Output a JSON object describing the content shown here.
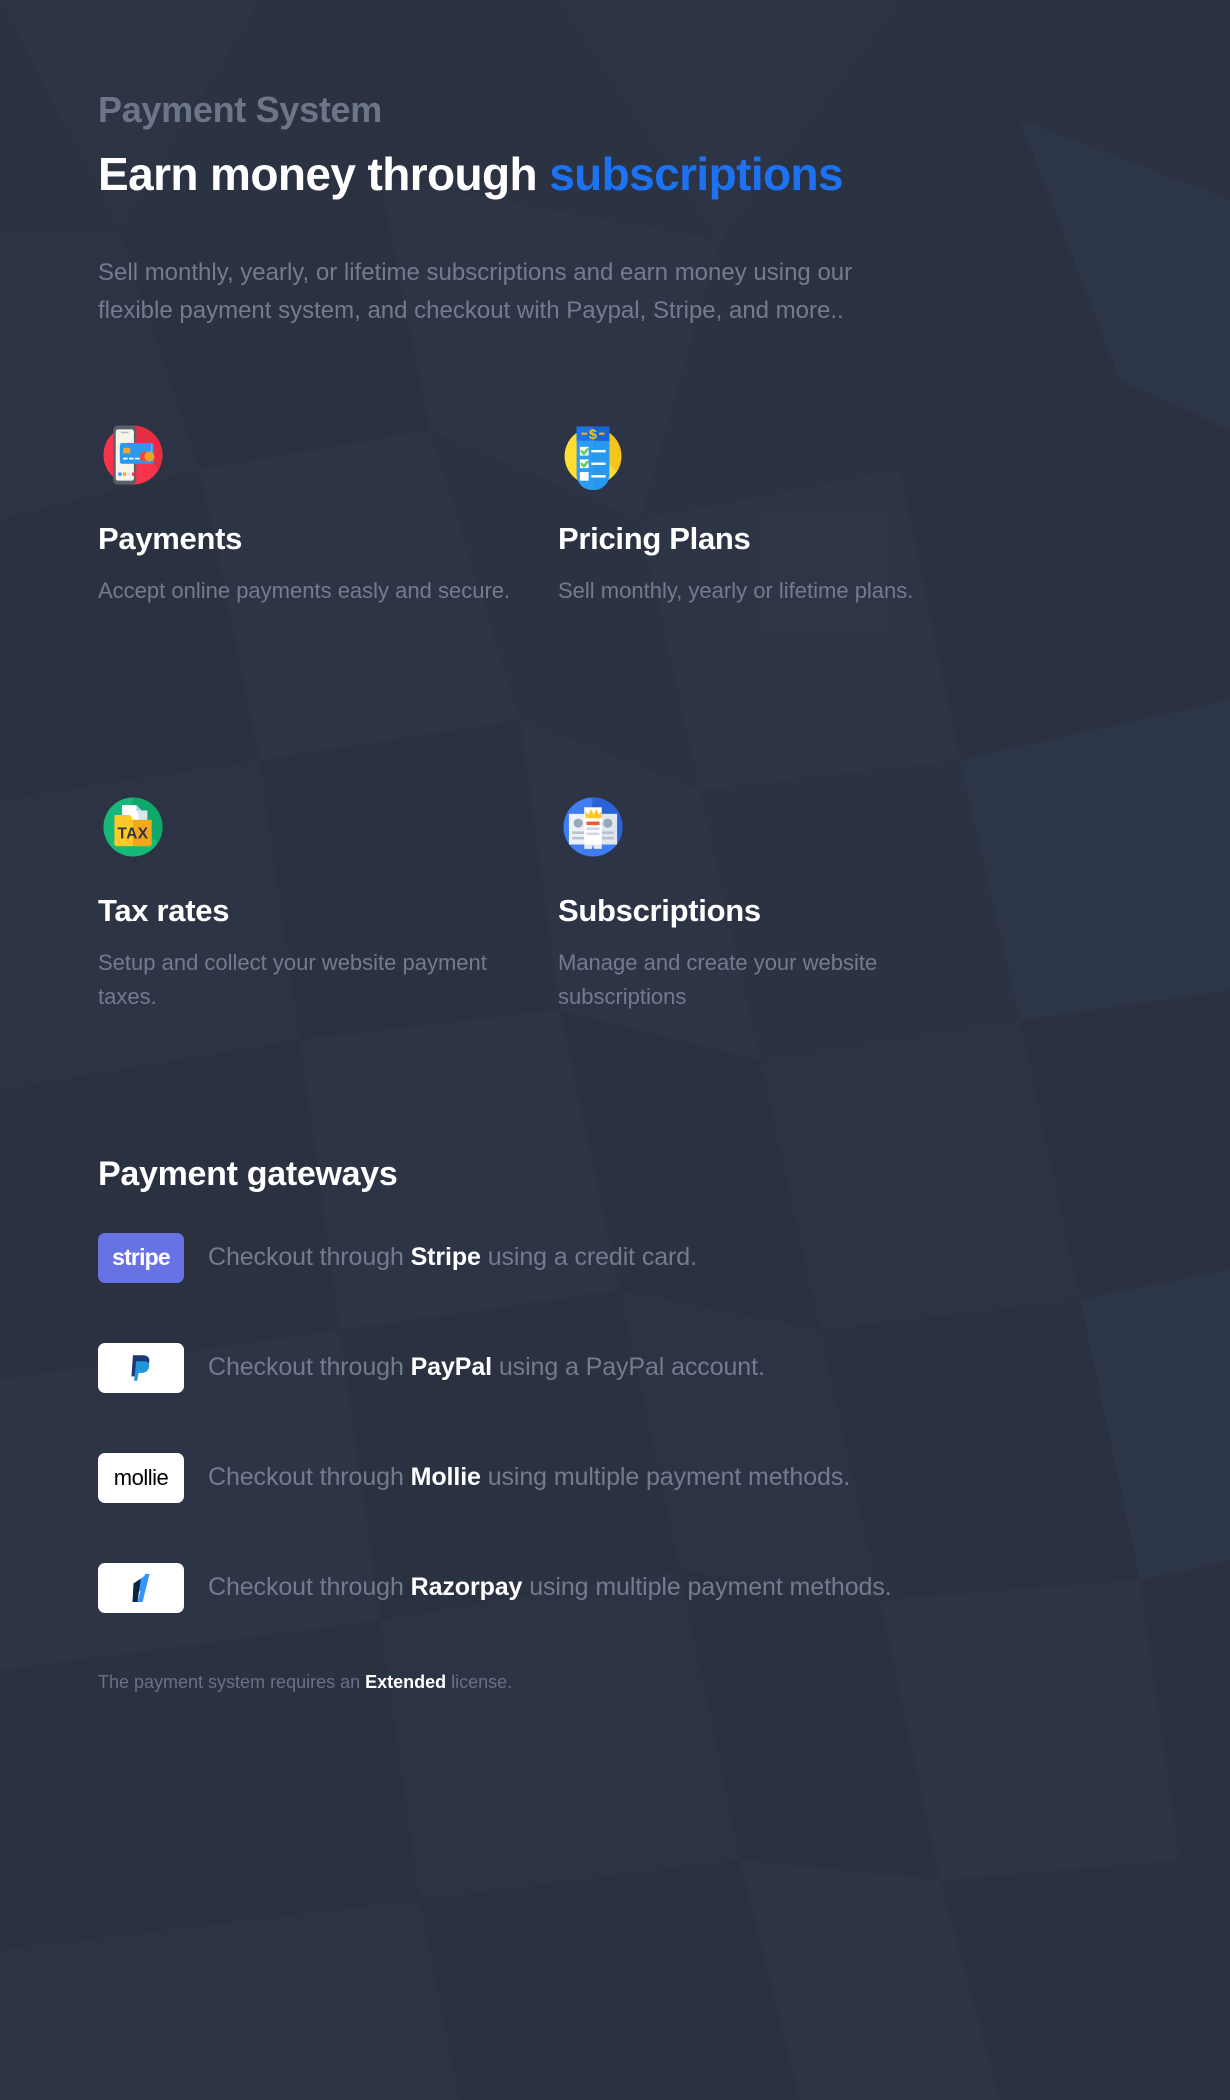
{
  "hero": {
    "eyebrow": "Payment System",
    "headline_lead": "Earn money through ",
    "headline_accent": "subscriptions",
    "description": "Sell monthly, yearly, or lifetime subscriptions and earn money using our flexible payment system, and checkout with Paypal, Stripe, and more.."
  },
  "features": [
    {
      "icon": "mobile-credit-card-icon",
      "title": "Payments",
      "description": "Accept online payments easly and secure."
    },
    {
      "icon": "price-checklist-icon",
      "title": "Pricing Plans",
      "description": "Sell monthly, yearly or lifetime plans."
    },
    {
      "icon": "tax-folder-icon",
      "title": "Tax rates",
      "description": "Setup and collect your website payment taxes."
    },
    {
      "icon": "subscription-crown-icon",
      "title": "Subscriptions",
      "description": "Manage and create your website subscriptions"
    }
  ],
  "gateways": {
    "title": "Payment gateways",
    "items": [
      {
        "logo": "stripe-logo",
        "logo_text": "stripe",
        "prefix": "Checkout through ",
        "name": "Stripe",
        "suffix": " using a credit card."
      },
      {
        "logo": "paypal-logo",
        "logo_text": "",
        "prefix": "Checkout through ",
        "name": "PayPal",
        "suffix": " using a PayPal account."
      },
      {
        "logo": "mollie-logo",
        "logo_text": "mollie",
        "prefix": "Checkout through ",
        "name": "Mollie",
        "suffix": " using multiple payment methods."
      },
      {
        "logo": "razorpay-logo",
        "logo_text": "",
        "prefix": "Checkout through ",
        "name": "Razorpay",
        "suffix": " using multiple payment methods."
      }
    ],
    "license_prefix": "The payment system requires an ",
    "license_name": "Extended",
    "license_suffix": " license."
  },
  "colors": {
    "background": "#2b3242",
    "accent": "#1d72f2",
    "heading": "#ffffff",
    "muted": "#737c8e",
    "eyebrow": "#6d7689",
    "stripe_purple": "#6772e5"
  }
}
